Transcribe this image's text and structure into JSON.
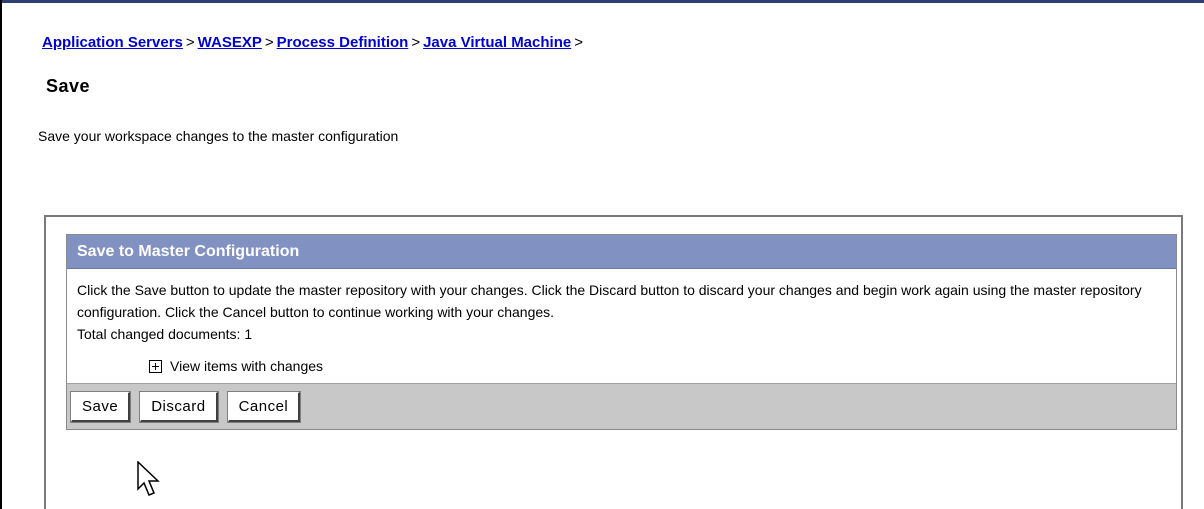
{
  "breadcrumb": {
    "items": [
      {
        "label": "Application Servers"
      },
      {
        "label": "WASEXP"
      },
      {
        "label": "Process Definition"
      },
      {
        "label": "Java Virtual Machine"
      }
    ],
    "separator": ">"
  },
  "page": {
    "title": "Save",
    "description": "Save your workspace changes to the master configuration"
  },
  "panel": {
    "header": "Save to Master Configuration",
    "body_text": "Click the Save button to update the master repository with your changes. Click the Discard button to discard your changes and begin work again using the master repository configuration. Click the Cancel button to continue working with your changes.",
    "total_changed": "Total changed documents: 1",
    "view_items_label": "View items with changes"
  },
  "buttons": {
    "save": "Save",
    "discard": "Discard",
    "cancel": "Cancel"
  },
  "colors": {
    "header_bg": "#8191c2",
    "link": "#0000cc",
    "button_bar": "#c8c8c8"
  },
  "icons": {
    "expand": "plus-box-icon",
    "cursor": "mouse-pointer-icon"
  }
}
